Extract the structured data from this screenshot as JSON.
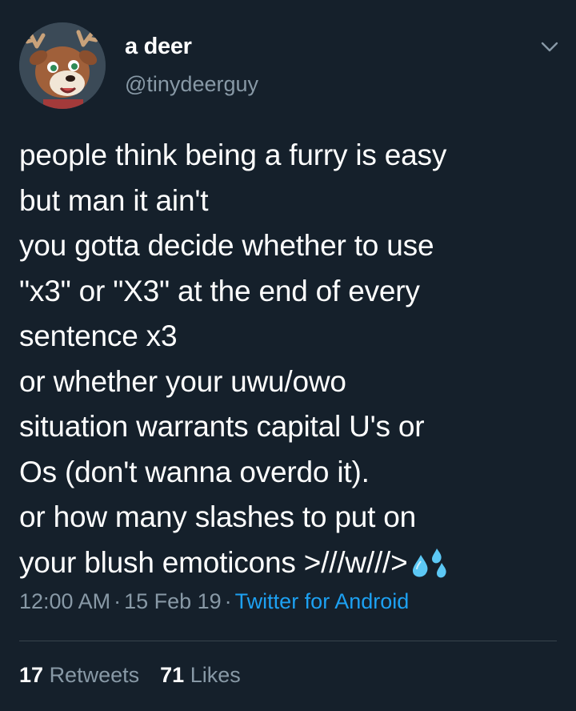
{
  "tweet": {
    "author": {
      "display_name": "a deer",
      "handle": "@tinydeerguy",
      "avatar_icon": "deer-avatar-icon"
    },
    "menu_icon": "chevron-down-icon",
    "text": "people think being a furry is easy\nbut man it ain't\nyou gotta decide whether to use\n\"x3\" or \"X3\" at the end of every\nsentence x3\nor whether your uwu/owo\nsituation warrants capital U's or\nOs (don't wanna overdo it).\nor how many slashes to put on\nyour blush emoticons >///w///>",
    "emoji": "sweat-droplets-icon",
    "time": "12:00 AM",
    "date": "15 Feb 19",
    "source": "Twitter for Android",
    "separator": "·",
    "retweets_count": "17",
    "retweets_label": "Retweets",
    "likes_count": "71",
    "likes_label": "Likes"
  },
  "colors": {
    "background": "#15202b",
    "text": "#ffffff",
    "secondary": "#8899a6",
    "link": "#1da1f2",
    "divider": "#38444d"
  }
}
